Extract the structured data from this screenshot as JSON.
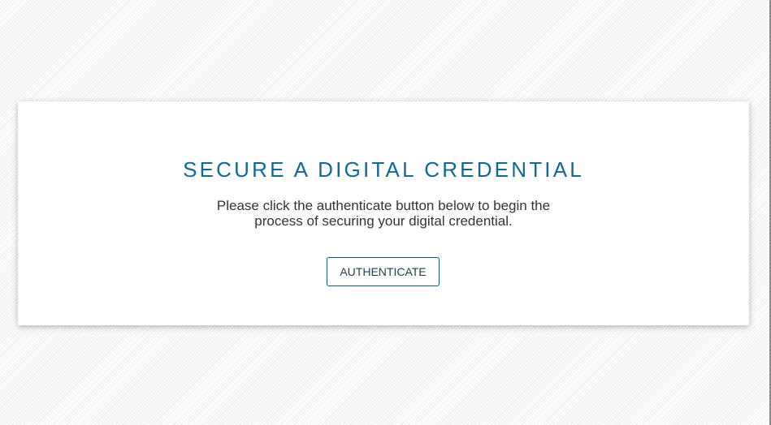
{
  "dialog": {
    "title": "SECURE A DIGITAL CREDENTIAL",
    "description": "Please click the authenticate button below to begin the process of securing your digital credential.",
    "authenticate_label": "AUTHENTICATE"
  },
  "colors": {
    "title": "#0e6a92",
    "button_border": "#0e5877",
    "body_text": "#333333"
  }
}
